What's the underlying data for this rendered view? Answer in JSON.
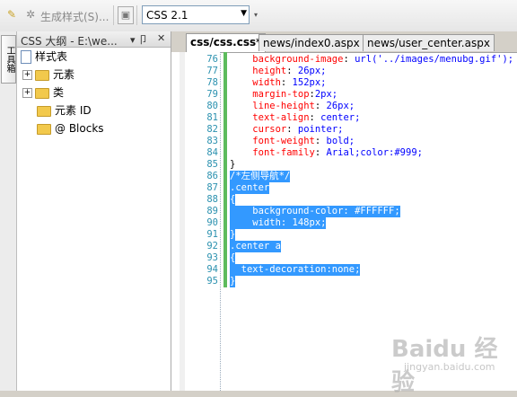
{
  "toolbar": {
    "generate_label": "生成样式(S)...",
    "css_version": "CSS 2.1"
  },
  "sidetab": {
    "label": "工具箱"
  },
  "panel": {
    "title": "CSS 大纲 - E:\\we...",
    "pin": "▾ 卩",
    "close": "✕",
    "tree": [
      {
        "label": "样式表",
        "icon": "stylesheet-icon"
      },
      {
        "label": "元素",
        "icon": "folder-icon"
      },
      {
        "label": "类",
        "icon": "folder-icon"
      },
      {
        "label": "元素 ID",
        "icon": "folder-icon"
      },
      {
        "label": "@ Blocks",
        "icon": "folder-icon"
      }
    ]
  },
  "tabs": [
    {
      "label": "css/css.css*",
      "active": true
    },
    {
      "label": "news/index0.aspx",
      "active": false
    },
    {
      "label": "news/user_center.aspx",
      "active": false
    }
  ],
  "code_lines": [
    {
      "n": "76",
      "text": "    background-image: url('../images/menubg.gif');",
      "sel": false
    },
    {
      "n": "77",
      "text": "    height: 26px;",
      "sel": false
    },
    {
      "n": "78",
      "text": "    width: 152px;",
      "sel": false
    },
    {
      "n": "79",
      "text": "    margin-top:2px;",
      "sel": false
    },
    {
      "n": "80",
      "text": "    line-height: 26px;",
      "sel": false
    },
    {
      "n": "81",
      "text": "    text-align: center;",
      "sel": false
    },
    {
      "n": "82",
      "text": "    cursor: pointer;",
      "sel": false
    },
    {
      "n": "83",
      "text": "    font-weight: bold;",
      "sel": false
    },
    {
      "n": "84",
      "text": "    font-family: Arial;color:#999;",
      "sel": false
    },
    {
      "n": "85",
      "text": "}",
      "sel": false
    },
    {
      "n": "86",
      "text": "/*左侧导航*/",
      "sel": true
    },
    {
      "n": "87",
      "text": ".center",
      "sel": true
    },
    {
      "n": "88",
      "text": "{",
      "sel": true
    },
    {
      "n": "89",
      "text": "    background-color: #FFFFFF;",
      "sel": true
    },
    {
      "n": "90",
      "text": "    width: 148px;",
      "sel": true
    },
    {
      "n": "91",
      "text": "}",
      "sel": true
    },
    {
      "n": "92",
      "text": ".center a",
      "sel": true
    },
    {
      "n": "93",
      "text": "{",
      "sel": true
    },
    {
      "n": "94",
      "text": "  text-decoration:none;",
      "sel": true
    },
    {
      "n": "95",
      "text": "}",
      "sel": true
    }
  ],
  "watermark": {
    "main": "Baidu 经验",
    "sub": "jingyan.baidu.com"
  }
}
